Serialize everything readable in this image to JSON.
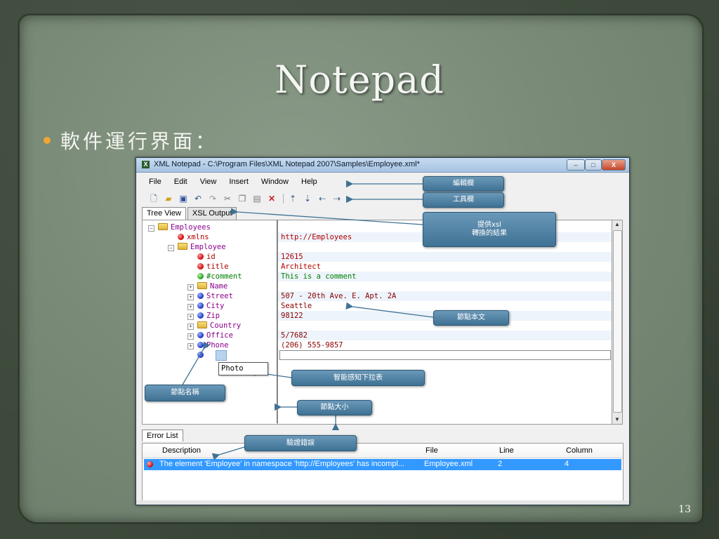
{
  "slide": {
    "title": "Notepad",
    "bullet": "軟件運行界面：",
    "page_number": "13"
  },
  "colors": {
    "bullet": "#f0a637",
    "callout": "#4f82a5",
    "selection": "#3399ff"
  },
  "window": {
    "title": "XML Notepad - C:\\Program Files\\XML Notepad 2007\\Samples\\Employee.xml*",
    "controls": {
      "minimize": "–",
      "maximize": "□",
      "close": "X"
    }
  },
  "menu": [
    "File",
    "Edit",
    "View",
    "Insert",
    "Window",
    "Help"
  ],
  "toolbar": [
    "new-icon",
    "open-icon",
    "save-icon",
    "undo-icon",
    "redo-icon",
    "cut-icon",
    "copy-icon",
    "paste-icon",
    "delete-icon",
    "nudge-up-icon",
    "nudge-down-icon",
    "nudge-left-icon",
    "nudge-right-icon"
  ],
  "tabs": {
    "tree_view": "Tree View",
    "xsl_output": "XSL Output"
  },
  "tree": [
    {
      "expander": "–",
      "icon": "folder",
      "label": "Employees",
      "value": ""
    },
    {
      "expander": "",
      "icon": "red",
      "label": "xmlns",
      "value": "http://Employees"
    },
    {
      "expander": "–",
      "icon": "folder",
      "label": "Employee",
      "value": ""
    },
    {
      "expander": "",
      "icon": "red",
      "label": "id",
      "value": "12615"
    },
    {
      "expander": "",
      "icon": "red",
      "label": "title",
      "value": "Architect"
    },
    {
      "expander": "",
      "icon": "green",
      "label": "#comment",
      "value": "This is a comment"
    },
    {
      "expander": "+",
      "icon": "folder",
      "label": "Name",
      "value": ""
    },
    {
      "expander": "+",
      "icon": "blue",
      "label": "Street",
      "value": "507 - 20th Ave. E. Apt. 2A"
    },
    {
      "expander": "+",
      "icon": "blue",
      "label": "City",
      "value": "Seattle"
    },
    {
      "expander": "+",
      "icon": "blue",
      "label": "Zip",
      "value": "98122"
    },
    {
      "expander": "+",
      "icon": "folder",
      "label": "Country",
      "value": ""
    },
    {
      "expander": "+",
      "icon": "blue",
      "label": "Office",
      "value": "5/7682"
    },
    {
      "expander": "+",
      "icon": "blue",
      "label": "Phone",
      "value": "(206) 555-9857"
    },
    {
      "expander": "",
      "icon": "blue",
      "label": "",
      "value": ""
    }
  ],
  "intellisense": "Photo",
  "error_list": {
    "tab": "Error List",
    "columns": {
      "description": "Description",
      "file": "File",
      "line": "Line",
      "column": "Column"
    },
    "row": {
      "description": "The element 'Employee' in namespace 'http://Employees' has incompl...",
      "file": "Employee.xml",
      "line": "2",
      "column": "4"
    }
  },
  "callouts": {
    "menu_bar": "編輯欄",
    "toolbar": "工具欄",
    "xsl_line1": "提供xsl",
    "xsl_line2": "轉換的結果",
    "node_text": "節點本文",
    "intellisense": "智能感知下拉表",
    "node_name": "節點名稱",
    "node_size": "節點大小",
    "validation": "驗證錯誤"
  }
}
